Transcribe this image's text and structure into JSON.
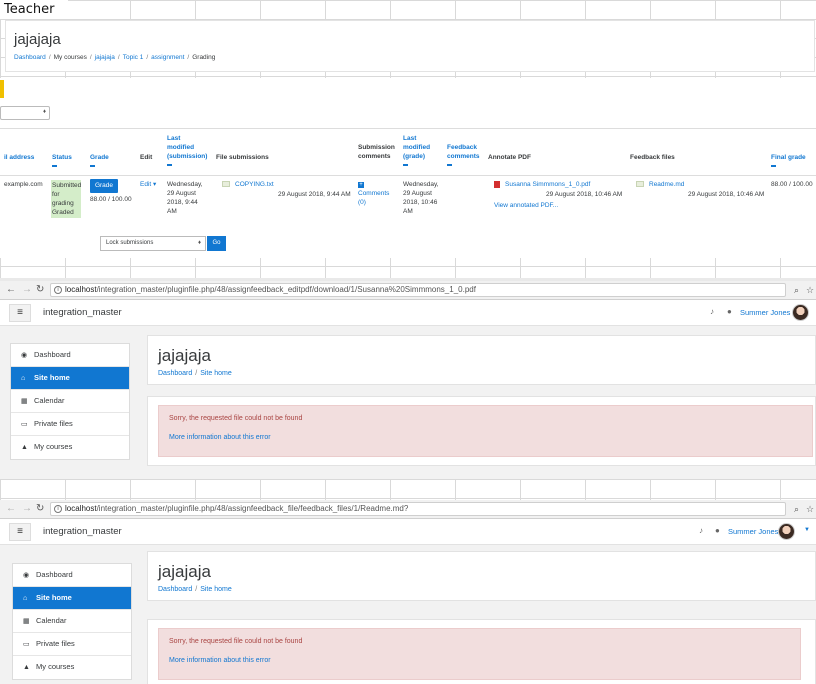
{
  "sheet": {
    "header": "Teacher"
  },
  "grading": {
    "course_title": "jajajaja",
    "breadcrumb": [
      "Dashboard",
      "My courses",
      "jajajaja",
      "Topic 1",
      "assignment",
      "Grading"
    ],
    "columns": {
      "email": "il address",
      "status": "Status",
      "grade": "Grade",
      "edit": "Edit",
      "last_modified_submission": [
        "Last",
        "modified",
        "(submission)"
      ],
      "file_submissions": "File submissions",
      "submission_comments": [
        "Submission",
        "comments"
      ],
      "last_modified_grade": [
        "Last",
        "modified",
        "(grade)"
      ],
      "feedback_comments": [
        "Feedback",
        "comments"
      ],
      "annotate_pdf": "Annotate PDF",
      "feedback_files": "Feedback files",
      "final_grade": "Final grade"
    },
    "row": {
      "email": "example.com",
      "status": [
        "Submitted",
        "for",
        "grading",
        "Graded"
      ],
      "grade_button": "Grade",
      "grade_value": "88.00 / 100.00",
      "edit": "Edit",
      "last_modified_submission": [
        "Wednesday,",
        "29 August",
        "2018, 9:44",
        "AM"
      ],
      "file_name": "COPYING.txt",
      "file_date": "29 August 2018, 9:44 AM",
      "comments": [
        "Comments",
        "(0)"
      ],
      "last_modified_grade": [
        "Wednesday,",
        "29 August",
        "2018, 10:46",
        "AM"
      ],
      "pdf_name": "Susanna Simmmons_1_0.pdf",
      "pdf_date": "29 August 2018, 10:46 AM",
      "view_annotated": "View annotated PDF...",
      "feedback_file": "Readme.md",
      "feedback_date": "29 August 2018, 10:46 AM",
      "final_grade": "88.00 / 100.00"
    },
    "lock_select": "Lock submissions",
    "go_button": "Go"
  },
  "browser1": {
    "url_host": "localhost",
    "url_path": "/integration_master/pluginfile.php/48/assignfeedback_editpdf/download/1/Susanna%20Simmmons_1_0.pdf"
  },
  "browser2": {
    "url_host": "localhost",
    "url_path": "/integration_master/pluginfile.php/48/assignfeedback_file/feedback_files/1/Readme.md?"
  },
  "site": {
    "name": "integration_master",
    "user": "Summer Jones",
    "page_title": "jajajaja",
    "breadcrumb": [
      "Dashboard",
      "Site home"
    ],
    "sidebar": [
      {
        "label": "Dashboard",
        "icon": "dashboard-icon",
        "glyph": "◉"
      },
      {
        "label": "Site home",
        "icon": "home-icon",
        "glyph": "⌂"
      },
      {
        "label": "Calendar",
        "icon": "calendar-icon",
        "glyph": "▦"
      },
      {
        "label": "Private files",
        "icon": "file-icon",
        "glyph": "▭"
      },
      {
        "label": "My courses",
        "icon": "graduation-cap-icon",
        "glyph": "▲"
      }
    ],
    "error_message": "Sorry, the requested file could not be found",
    "error_link": "More information about this error"
  },
  "colors": {
    "accent": "#1177d1",
    "error_bg": "#f2dede",
    "error_text": "#a94442",
    "status_bg": "#d4edc9"
  }
}
